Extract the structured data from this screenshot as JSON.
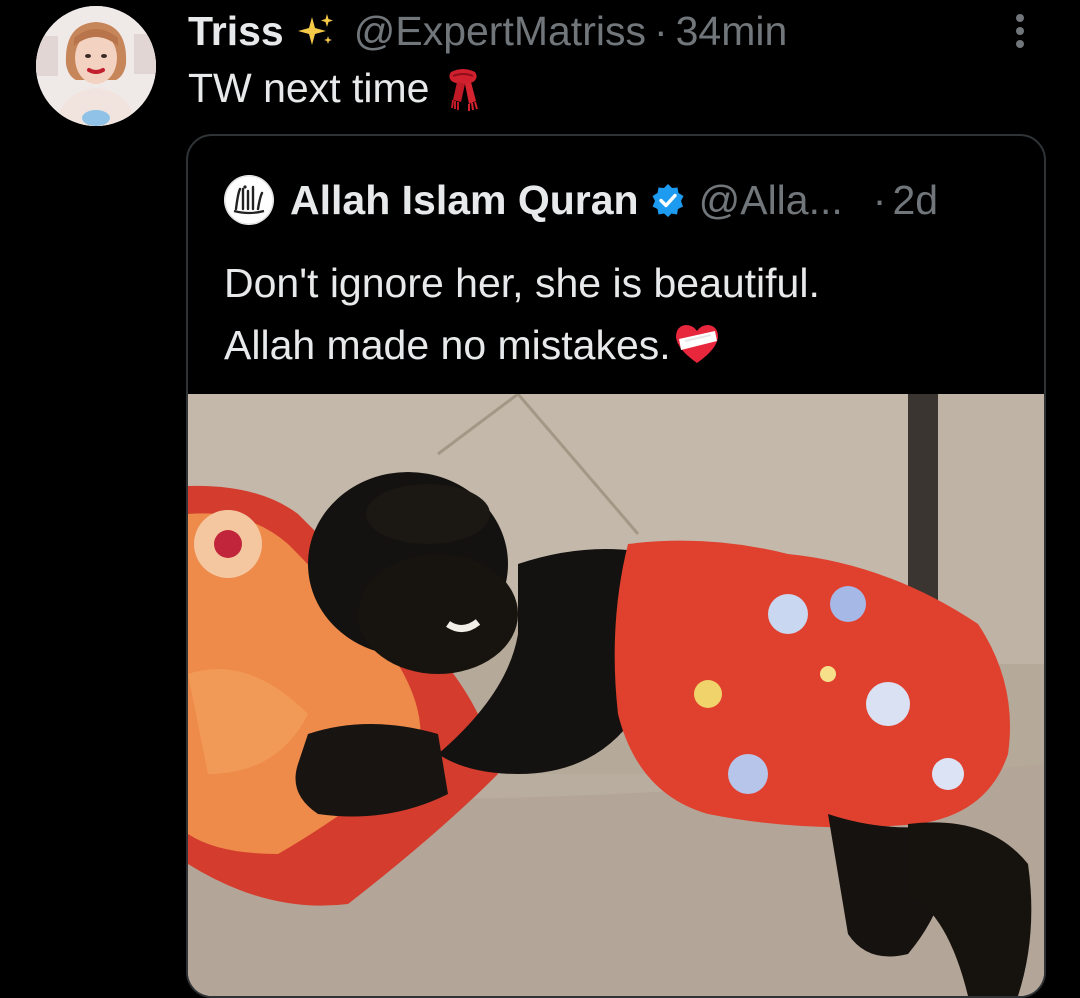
{
  "post": {
    "author": {
      "display_name": "Triss",
      "handle": "@ExpertMatriss",
      "separator": "·",
      "time": "34min",
      "avatar_icon": "profile-photo"
    },
    "text": "TW next time",
    "emoji_icon": "scarf-icon",
    "more_icon": "more-vertical-icon"
  },
  "quoted_post": {
    "author": {
      "display_name": "Allah Islam Quran",
      "verified": true,
      "verified_color": "#1d9bf0",
      "handle": "@Alla...",
      "separator": "·",
      "time": "2d",
      "avatar_icon": "calligraphy-logo"
    },
    "text_lines": [
      "Don't ignore her, she is beautiful.",
      "Allah made no mistakes."
    ],
    "emoji_icon": "mending-heart-icon",
    "media_icon": "photo-child-on-sofa"
  },
  "colors": {
    "background": "#000000",
    "primary_text": "#e7e9ea",
    "secondary_text": "#71767b",
    "border": "#2f3336"
  }
}
